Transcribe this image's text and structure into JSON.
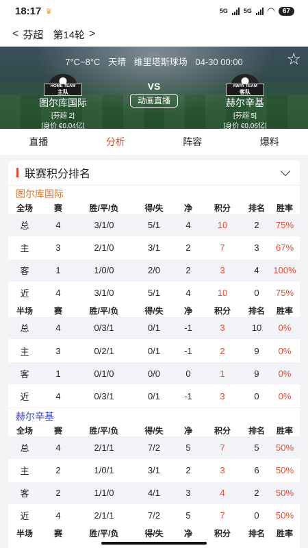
{
  "status": {
    "time": "18:17",
    "net1": "5G",
    "net2": "5G",
    "battery": "67"
  },
  "nav": {
    "league": "芬超",
    "round": "第14轮"
  },
  "match": {
    "temperature": "7°C~8°C",
    "weather": "天晴",
    "venue": "维里塔斯球场",
    "datetime": "04-30 00:00",
    "vs": "VS",
    "live_label": "动画直播",
    "home": {
      "badge": "HOME TEAM",
      "badge_text": "主队",
      "name": "图尔库国际",
      "rank": "[芬超 2]",
      "value": "[身价 €0.04亿]"
    },
    "away": {
      "badge": "AWAY TEAM",
      "badge_text": "客队",
      "name": "赫尔辛基",
      "rank": "[芬超 5]",
      "value": "[身价 €0.06亿]"
    }
  },
  "tabs": [
    "直播",
    "分析",
    "阵容",
    "爆料"
  ],
  "active_tab": 1,
  "section": {
    "title": "联赛积分排名"
  },
  "colors": {
    "accent": "#e8492f",
    "home": "#d9762a",
    "away": "#3b45c9",
    "row_alt": "#f2f3f7"
  },
  "standings": {
    "full_headers": [
      "全场",
      "赛",
      "胜/平/负",
      "得/失",
      "净",
      "积分",
      "排名",
      "胜率"
    ],
    "half_headers": [
      "半场",
      "赛",
      "胜/平/负",
      "得/失",
      "净",
      "积分",
      "排名",
      "胜率"
    ],
    "home": {
      "name": "图尔库国际",
      "full": [
        [
          "总",
          "4",
          "3/1/0",
          "5/1",
          "4",
          "10",
          "2",
          "75%"
        ],
        [
          "主",
          "3",
          "2/1/0",
          "3/1",
          "2",
          "7",
          "3",
          "67%"
        ],
        [
          "客",
          "1",
          "1/0/0",
          "2/0",
          "2",
          "3",
          "4",
          "100%"
        ],
        [
          "近",
          "4",
          "3/1/0",
          "5/1",
          "4",
          "10",
          "0",
          "75%"
        ]
      ],
      "half": [
        [
          "总",
          "4",
          "0/3/1",
          "0/1",
          "-1",
          "3",
          "10",
          "0%"
        ],
        [
          "主",
          "3",
          "0/2/1",
          "0/1",
          "-1",
          "2",
          "9",
          "0%"
        ],
        [
          "客",
          "1",
          "0/1/0",
          "0/0",
          "0",
          "1",
          "9",
          "0%"
        ],
        [
          "近",
          "4",
          "0/3/1",
          "0/1",
          "-1",
          "3",
          "0",
          "0%"
        ]
      ]
    },
    "away": {
      "name": "赫尔辛基",
      "full": [
        [
          "总",
          "4",
          "2/1/1",
          "7/2",
          "5",
          "7",
          "5",
          "50%"
        ],
        [
          "主",
          "2",
          "1/0/1",
          "3/1",
          "2",
          "3",
          "6",
          "50%"
        ],
        [
          "客",
          "2",
          "1/1/0",
          "4/1",
          "3",
          "4",
          "2",
          "50%"
        ],
        [
          "近",
          "4",
          "2/1/1",
          "7/2",
          "5",
          "7",
          "0",
          "50%"
        ]
      ]
    }
  }
}
